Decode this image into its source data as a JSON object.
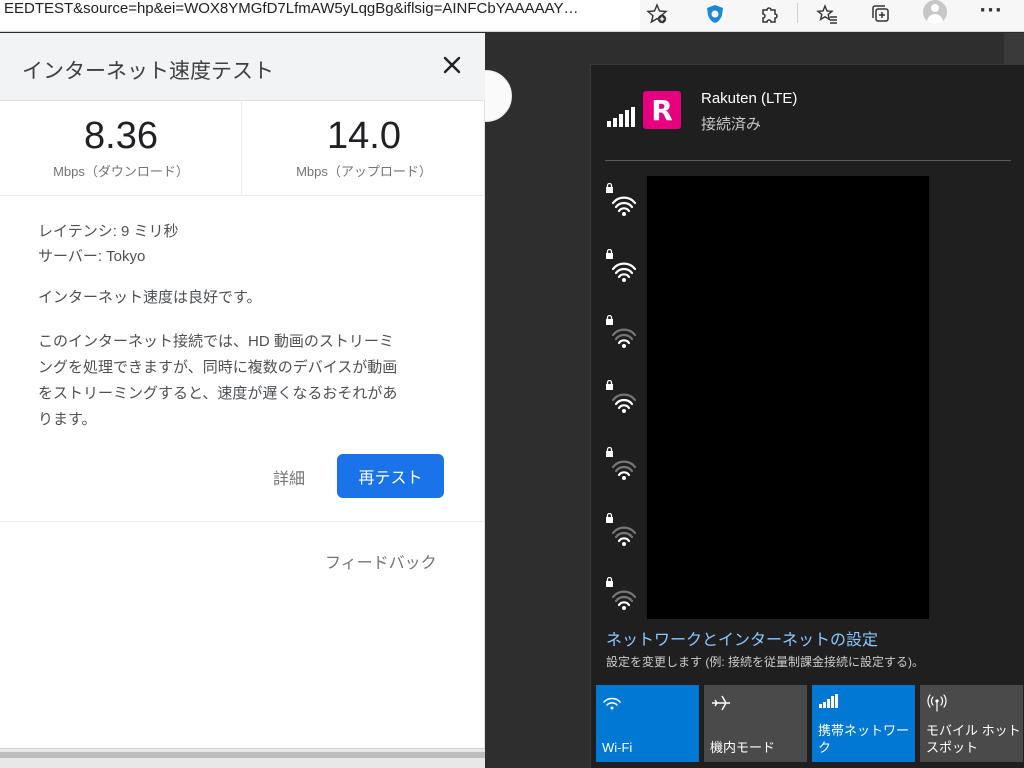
{
  "browser": {
    "url": "EEDTEST&source=hp&ei=WOX8YMGfD7LfmAW5yLqgBg&iflsig=AINFCbYAAAAAY…",
    "icons": [
      "add-favorite-icon",
      "extension-shield-icon",
      "extensions-icon",
      "favorites-icon",
      "collections-icon",
      "profile-icon",
      "more-icon"
    ],
    "more_label": "···"
  },
  "speedtest": {
    "title": "インターネット速度テスト",
    "download": {
      "value": "8.36",
      "label": "Mbps（ダウンロード）"
    },
    "upload": {
      "value": "14.0",
      "label": "Mbps（アップロード）"
    },
    "latency": "レイテンシ: 9 ミリ秒",
    "server": "サーバー: Tokyo",
    "verdict": "インターネット速度は良好です。",
    "description_lines": [
      "このインターネット接続では、HD 動画のストリーミ",
      "ングを処理できますが、同時に複数のデバイスが動画",
      "をストリーミングすると、速度が遅くなるおそれがあ",
      "ります。"
    ],
    "details_label": "詳細",
    "retest_label": "再テスト",
    "feedback_label": "フィードバック"
  },
  "network_flyout": {
    "connection": {
      "name": "Rakuten (LTE)",
      "status": "接続済み",
      "logo_letter": "R"
    },
    "wifi_networks_count_visible": 7,
    "settings_link": "ネットワークとインターネットの設定",
    "settings_desc": "設定を変更します (例: 接続を従量制課金接続に設定する)。",
    "quick_actions": [
      {
        "label": "Wi-Fi",
        "icon": "wifi-icon",
        "active": true
      },
      {
        "label": "機内モード",
        "icon": "airplane-icon",
        "active": false
      },
      {
        "label": "携帯ネットワーク",
        "icon": "cellular-icon",
        "active": true
      },
      {
        "label": "モバイル ホットスポット",
        "icon": "hotspot-icon",
        "active": false
      }
    ]
  },
  "colors": {
    "accent_blue": "#1a73e8",
    "windows_blue": "#0078d4",
    "rakuten_pink": "#e60080",
    "flyout_bg": "#1f1f1f"
  }
}
